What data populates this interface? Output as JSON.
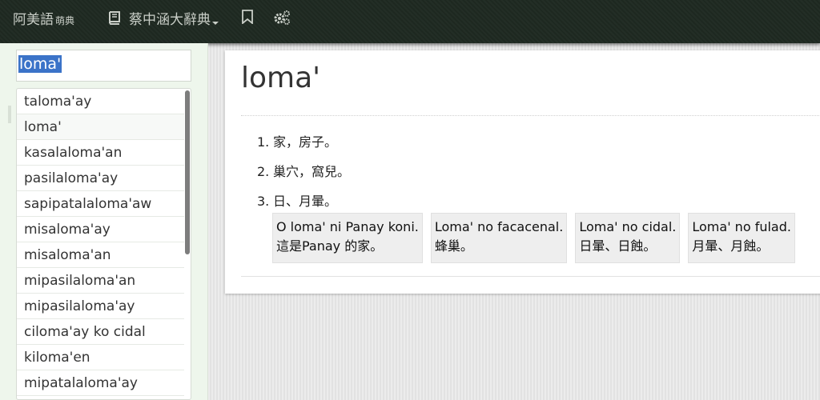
{
  "topbar": {
    "brand": "阿美語",
    "brand_sub": "萌典",
    "dictionary": "蔡中涵大辭典",
    "icons": [
      "book-icon",
      "bookmark-icon",
      "gear-icon"
    ]
  },
  "search": {
    "value": "loma'"
  },
  "results": [
    "taloma'ay",
    "loma'",
    "kasalaloma'an",
    "pasilaloma'ay",
    "sapipatalaloma'aw",
    "misaloma'ay",
    "misaloma'an",
    "mipasilaloma'an",
    "mipasilaloma'ay",
    "ciloma'ay ko cidal",
    "kiloma'en",
    "mipatalaloma'ay"
  ],
  "entry": {
    "title": "loma'",
    "definitions": [
      {
        "num": "1.",
        "text": "家，房子。"
      },
      {
        "num": "2.",
        "text": "巢穴，窩兒。"
      },
      {
        "num": "3.",
        "text": "日、月暈。"
      }
    ],
    "examples": [
      {
        "amis": "O loma' ni Panay koni.",
        "zh": "這是Panay 的家。"
      },
      {
        "amis": "Loma' no facacenal.",
        "zh": "蜂巢。"
      },
      {
        "amis": "Loma' no cidal.",
        "zh": "日暈、日蝕。"
      },
      {
        "amis": "Loma' no fulad.",
        "zh": "月暈、月蝕。"
      }
    ]
  },
  "colors": {
    "topbar": "#1f2a22",
    "sidebar": "#eef6ec",
    "selection": "#3b73c8"
  }
}
